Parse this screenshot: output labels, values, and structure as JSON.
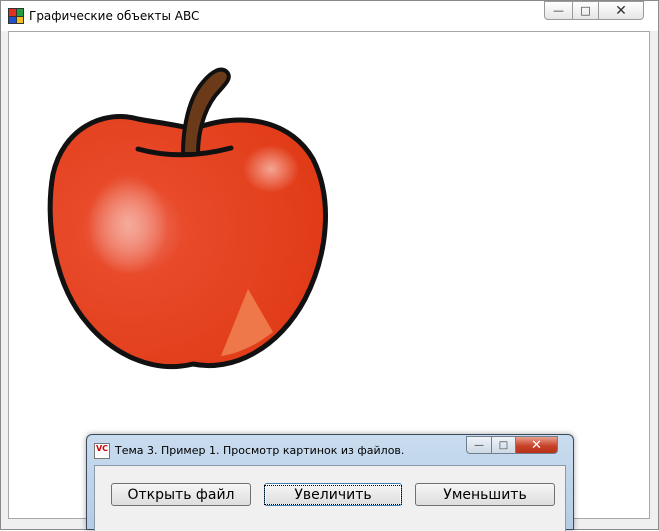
{
  "main_window": {
    "title": "Графические объекты ABC",
    "controls": {
      "minimize": "—",
      "maximize": "□",
      "close": "✕"
    }
  },
  "image": {
    "subject": "apple-icon"
  },
  "dialog": {
    "title": "Тема 3. Пример 1. Просмотр картинок из файлов.",
    "icon_text": "VC",
    "controls": {
      "minimize": "—",
      "maximize": "□",
      "close": "✕"
    },
    "buttons": {
      "open": "Открыть файл",
      "zoom_in": "Увеличить",
      "zoom_out": "Уменьшить"
    }
  }
}
